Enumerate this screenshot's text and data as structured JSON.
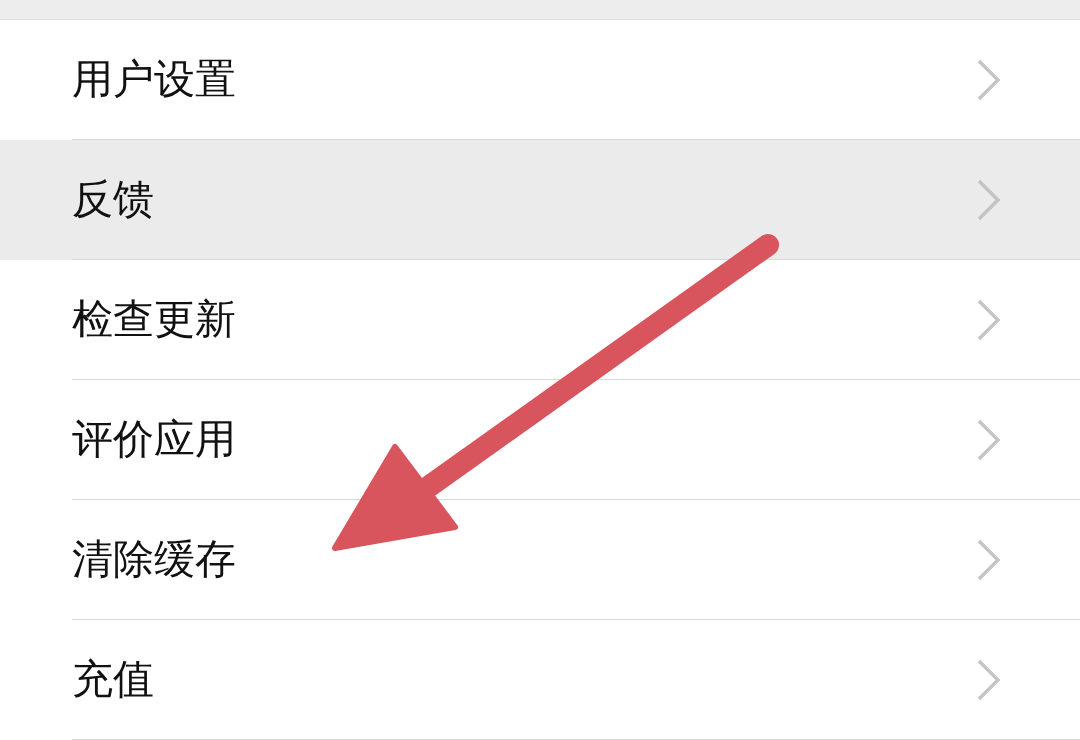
{
  "settings_list": [
    {
      "label": "用户设置",
      "selected": false
    },
    {
      "label": "反馈",
      "selected": true
    },
    {
      "label": "检查更新",
      "selected": false
    },
    {
      "label": "评价应用",
      "selected": false
    },
    {
      "label": "清除缓存",
      "selected": false
    },
    {
      "label": "充值",
      "selected": false
    }
  ]
}
